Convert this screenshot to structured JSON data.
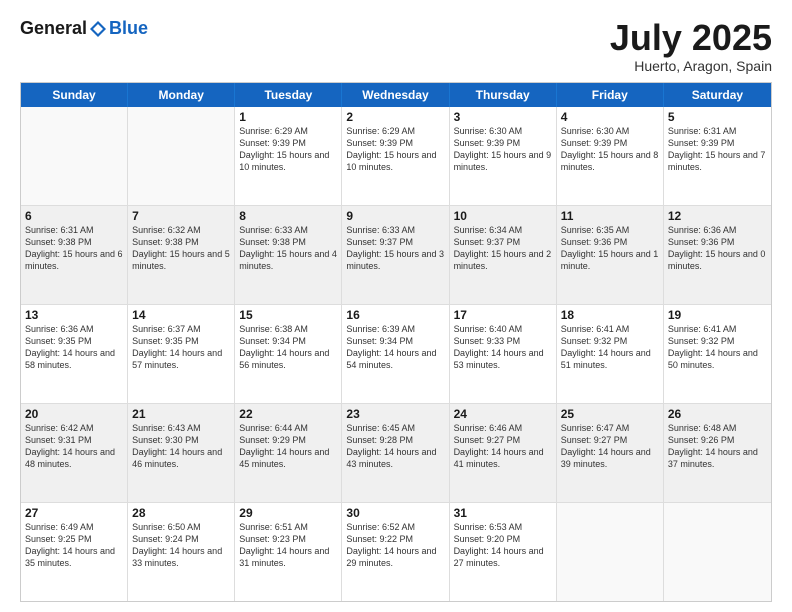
{
  "header": {
    "logo_general": "General",
    "logo_blue": "Blue",
    "month": "July 2025",
    "location": "Huerto, Aragon, Spain"
  },
  "days_of_week": [
    "Sunday",
    "Monday",
    "Tuesday",
    "Wednesday",
    "Thursday",
    "Friday",
    "Saturday"
  ],
  "weeks": [
    [
      {
        "day": "",
        "empty": true
      },
      {
        "day": "",
        "empty": true
      },
      {
        "day": "1",
        "sunrise": "Sunrise: 6:29 AM",
        "sunset": "Sunset: 9:39 PM",
        "daylight": "Daylight: 15 hours and 10 minutes."
      },
      {
        "day": "2",
        "sunrise": "Sunrise: 6:29 AM",
        "sunset": "Sunset: 9:39 PM",
        "daylight": "Daylight: 15 hours and 10 minutes."
      },
      {
        "day": "3",
        "sunrise": "Sunrise: 6:30 AM",
        "sunset": "Sunset: 9:39 PM",
        "daylight": "Daylight: 15 hours and 9 minutes."
      },
      {
        "day": "4",
        "sunrise": "Sunrise: 6:30 AM",
        "sunset": "Sunset: 9:39 PM",
        "daylight": "Daylight: 15 hours and 8 minutes."
      },
      {
        "day": "5",
        "sunrise": "Sunrise: 6:31 AM",
        "sunset": "Sunset: 9:39 PM",
        "daylight": "Daylight: 15 hours and 7 minutes."
      }
    ],
    [
      {
        "day": "6",
        "sunrise": "Sunrise: 6:31 AM",
        "sunset": "Sunset: 9:38 PM",
        "daylight": "Daylight: 15 hours and 6 minutes."
      },
      {
        "day": "7",
        "sunrise": "Sunrise: 6:32 AM",
        "sunset": "Sunset: 9:38 PM",
        "daylight": "Daylight: 15 hours and 5 minutes."
      },
      {
        "day": "8",
        "sunrise": "Sunrise: 6:33 AM",
        "sunset": "Sunset: 9:38 PM",
        "daylight": "Daylight: 15 hours and 4 minutes."
      },
      {
        "day": "9",
        "sunrise": "Sunrise: 6:33 AM",
        "sunset": "Sunset: 9:37 PM",
        "daylight": "Daylight: 15 hours and 3 minutes."
      },
      {
        "day": "10",
        "sunrise": "Sunrise: 6:34 AM",
        "sunset": "Sunset: 9:37 PM",
        "daylight": "Daylight: 15 hours and 2 minutes."
      },
      {
        "day": "11",
        "sunrise": "Sunrise: 6:35 AM",
        "sunset": "Sunset: 9:36 PM",
        "daylight": "Daylight: 15 hours and 1 minute."
      },
      {
        "day": "12",
        "sunrise": "Sunrise: 6:36 AM",
        "sunset": "Sunset: 9:36 PM",
        "daylight": "Daylight: 15 hours and 0 minutes."
      }
    ],
    [
      {
        "day": "13",
        "sunrise": "Sunrise: 6:36 AM",
        "sunset": "Sunset: 9:35 PM",
        "daylight": "Daylight: 14 hours and 58 minutes."
      },
      {
        "day": "14",
        "sunrise": "Sunrise: 6:37 AM",
        "sunset": "Sunset: 9:35 PM",
        "daylight": "Daylight: 14 hours and 57 minutes."
      },
      {
        "day": "15",
        "sunrise": "Sunrise: 6:38 AM",
        "sunset": "Sunset: 9:34 PM",
        "daylight": "Daylight: 14 hours and 56 minutes."
      },
      {
        "day": "16",
        "sunrise": "Sunrise: 6:39 AM",
        "sunset": "Sunset: 9:34 PM",
        "daylight": "Daylight: 14 hours and 54 minutes."
      },
      {
        "day": "17",
        "sunrise": "Sunrise: 6:40 AM",
        "sunset": "Sunset: 9:33 PM",
        "daylight": "Daylight: 14 hours and 53 minutes."
      },
      {
        "day": "18",
        "sunrise": "Sunrise: 6:41 AM",
        "sunset": "Sunset: 9:32 PM",
        "daylight": "Daylight: 14 hours and 51 minutes."
      },
      {
        "day": "19",
        "sunrise": "Sunrise: 6:41 AM",
        "sunset": "Sunset: 9:32 PM",
        "daylight": "Daylight: 14 hours and 50 minutes."
      }
    ],
    [
      {
        "day": "20",
        "sunrise": "Sunrise: 6:42 AM",
        "sunset": "Sunset: 9:31 PM",
        "daylight": "Daylight: 14 hours and 48 minutes."
      },
      {
        "day": "21",
        "sunrise": "Sunrise: 6:43 AM",
        "sunset": "Sunset: 9:30 PM",
        "daylight": "Daylight: 14 hours and 46 minutes."
      },
      {
        "day": "22",
        "sunrise": "Sunrise: 6:44 AM",
        "sunset": "Sunset: 9:29 PM",
        "daylight": "Daylight: 14 hours and 45 minutes."
      },
      {
        "day": "23",
        "sunrise": "Sunrise: 6:45 AM",
        "sunset": "Sunset: 9:28 PM",
        "daylight": "Daylight: 14 hours and 43 minutes."
      },
      {
        "day": "24",
        "sunrise": "Sunrise: 6:46 AM",
        "sunset": "Sunset: 9:27 PM",
        "daylight": "Daylight: 14 hours and 41 minutes."
      },
      {
        "day": "25",
        "sunrise": "Sunrise: 6:47 AM",
        "sunset": "Sunset: 9:27 PM",
        "daylight": "Daylight: 14 hours and 39 minutes."
      },
      {
        "day": "26",
        "sunrise": "Sunrise: 6:48 AM",
        "sunset": "Sunset: 9:26 PM",
        "daylight": "Daylight: 14 hours and 37 minutes."
      }
    ],
    [
      {
        "day": "27",
        "sunrise": "Sunrise: 6:49 AM",
        "sunset": "Sunset: 9:25 PM",
        "daylight": "Daylight: 14 hours and 35 minutes."
      },
      {
        "day": "28",
        "sunrise": "Sunrise: 6:50 AM",
        "sunset": "Sunset: 9:24 PM",
        "daylight": "Daylight: 14 hours and 33 minutes."
      },
      {
        "day": "29",
        "sunrise": "Sunrise: 6:51 AM",
        "sunset": "Sunset: 9:23 PM",
        "daylight": "Daylight: 14 hours and 31 minutes."
      },
      {
        "day": "30",
        "sunrise": "Sunrise: 6:52 AM",
        "sunset": "Sunset: 9:22 PM",
        "daylight": "Daylight: 14 hours and 29 minutes."
      },
      {
        "day": "31",
        "sunrise": "Sunrise: 6:53 AM",
        "sunset": "Sunset: 9:20 PM",
        "daylight": "Daylight: 14 hours and 27 minutes."
      },
      {
        "day": "",
        "empty": true
      },
      {
        "day": "",
        "empty": true
      }
    ]
  ]
}
